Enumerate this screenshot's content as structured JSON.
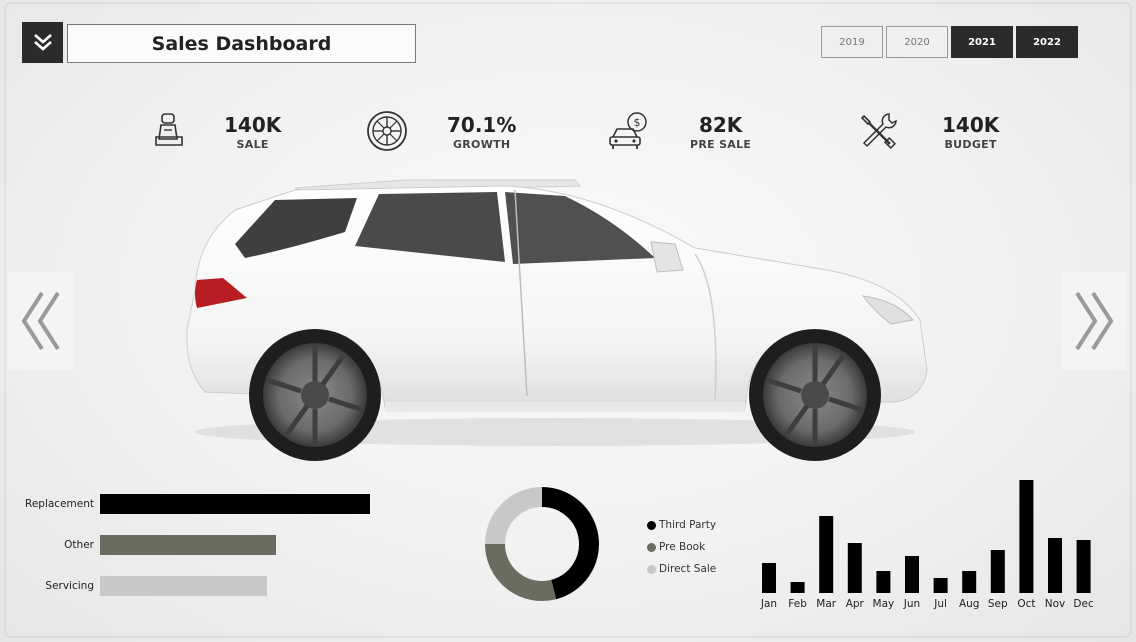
{
  "header": {
    "title": "Sales Dashboard",
    "years": [
      {
        "label": "2019",
        "active": false
      },
      {
        "label": "2020",
        "active": false
      },
      {
        "label": "2021",
        "active": true
      },
      {
        "label": "2022",
        "active": true
      }
    ]
  },
  "kpis": [
    {
      "icon": "car-seat-icon",
      "value": "140K",
      "label": "SALE"
    },
    {
      "icon": "tire-icon",
      "value": "70.1%",
      "label": "GROWTH"
    },
    {
      "icon": "car-dollar-icon",
      "value": "82K",
      "label": "PRE SALE"
    },
    {
      "icon": "tools-icon",
      "value": "140K",
      "label": "BUDGET"
    }
  ],
  "colors": {
    "dark": "#2b2b2b",
    "black": "#000000",
    "olive_gray": "#6b6b60",
    "light_gray": "#c8c8c8"
  },
  "chart_data": [
    {
      "type": "bar",
      "orientation": "horizontal",
      "categories": [
        "Replacement",
        "Other",
        "Servicing"
      ],
      "values": [
        270,
        176,
        167
      ],
      "colors": [
        "#000000",
        "#6b6b60",
        "#c8c8c8"
      ]
    },
    {
      "type": "pie",
      "donut": true,
      "labels": [
        "Third Party",
        "Pre Book",
        "Direct Sale"
      ],
      "values": [
        46,
        29,
        25
      ],
      "colors": [
        "#000000",
        "#6b6b60",
        "#c8c8c8"
      ]
    },
    {
      "type": "bar",
      "categories": [
        "Jan",
        "Feb",
        "Mar",
        "Apr",
        "May",
        "Jun",
        "Jul",
        "Aug",
        "Sep",
        "Oct",
        "Nov",
        "Dec"
      ],
      "values": [
        30,
        11,
        77,
        50,
        22,
        37,
        15,
        22,
        43,
        113,
        55,
        53
      ],
      "color": "#000000"
    }
  ]
}
